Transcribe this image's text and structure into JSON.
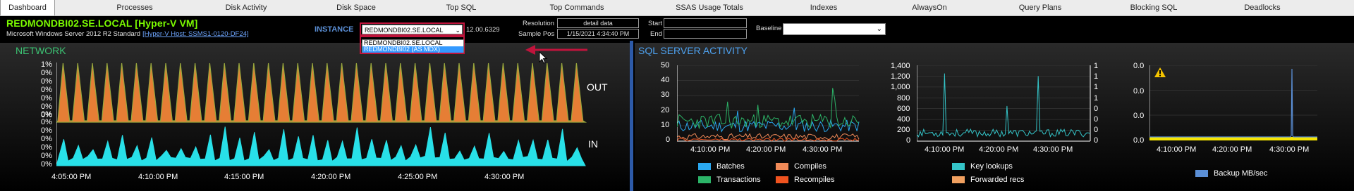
{
  "tabs": [
    {
      "label": "Dashboard",
      "active": true
    },
    {
      "label": "Processes"
    },
    {
      "label": "Disk Activity"
    },
    {
      "label": "Disk Space"
    },
    {
      "label": "Top SQL"
    },
    {
      "label": "Top Commands"
    },
    {
      "label": "SSAS Usage Totals"
    },
    {
      "label": "Indexes"
    },
    {
      "label": "AlwaysOn"
    },
    {
      "label": "Query Plans"
    },
    {
      "label": "Blocking SQL"
    },
    {
      "label": "Deadlocks"
    }
  ],
  "header": {
    "server_name": "REDMONDBI02.SE.LOCAL [Hyper-V VM]",
    "os": "Microsoft Windows Server 2012 R2 Standard",
    "host_link": "[Hyper-V Host: SSMS1-0120-DF24]",
    "instance_label": "INSTANCE",
    "instance_selected": "REDMONDBI02.SE.LOCAL",
    "version": "12.00.6329",
    "resolution_label": "Resolution",
    "resolution_value": "detail data",
    "sample_pos_label": "Sample Pos",
    "sample_pos_value": "1/15/2021 4:34:40 PM",
    "start_label": "Start",
    "end_label": "End",
    "baseline_label": "Baseline",
    "start_value": "",
    "end_value": "",
    "baseline_value": ""
  },
  "instance_options": [
    "REDMONDBI02.SE.LOCAL",
    "REDMONDBI02 (AS MDX)"
  ],
  "network": {
    "title": "NETWORK",
    "out_label": "OUT",
    "in_label": "IN",
    "out_yticks": [
      "1%",
      "0%",
      "0%",
      "0%",
      "0%",
      "0%",
      "0%",
      "0%",
      "0%"
    ],
    "in_yticks": [
      "0%",
      "0%",
      "0%",
      "0%",
      "0%",
      "0%",
      "0%",
      "0%"
    ],
    "xticks": [
      "4:05:00 PM",
      "4:10:00 PM",
      "4:15:00 PM",
      "4:20:00 PM",
      "4:25:00 PM",
      "4:30:00 PM"
    ]
  },
  "sql_activity": {
    "title": "SQL SERVER ACTIVITY",
    "c1_yticks": [
      "50",
      "40",
      "30",
      "20",
      "10",
      "0"
    ],
    "c1_xticks": [
      "4:10:00 PM",
      "4:20:00 PM",
      "4:30:00 PM"
    ],
    "c2_yticks": [
      "1,400",
      "1,200",
      "1,000",
      "800",
      "600",
      "400",
      "200",
      "0"
    ],
    "c2_y2ticks": [
      "1",
      "1",
      "1",
      "1",
      "0",
      "0",
      "0",
      "0"
    ],
    "c2_xticks": [
      "4:10:00 PM",
      "4:20:00 PM",
      "4:30:00 PM"
    ],
    "c3_yticks": [
      "0.0",
      "0.0",
      "0.0",
      "0.0"
    ],
    "c3_xticks": [
      "4:10:00 PM",
      "4:20:00 PM",
      "4:30:00 PM"
    ],
    "legend": {
      "batches": "Batches",
      "transactions": "Transactions",
      "compiles": "Compiles",
      "recompiles": "Recompiles",
      "key_lookups": "Key lookups",
      "forwarded_recs": "Forwarded recs",
      "backup": "Backup MB/sec"
    }
  },
  "colors": {
    "accent_green": "#7CFC00",
    "network_title": "#3cc373",
    "sql_title": "#4ea2f0",
    "out_fill": "#e67e35",
    "out_line": "#9aa83d",
    "in_fill": "#28e0e8",
    "batches": "#2aa8f0",
    "transactions": "#2cb468",
    "compiles": "#f08a58",
    "recompiles": "#f0531f",
    "key_lookups": "#34c4c8",
    "forwarded_recs": "#f0a060",
    "backup": "#5b8fd6",
    "highlight": "#c0143c"
  },
  "chart_data": [
    {
      "type": "area",
      "title": "",
      "series": [
        {
          "name": "OUT"
        },
        {
          "name": "IN"
        }
      ],
      "x": [
        "4:05:00 PM",
        "4:10:00 PM",
        "4:15:00 PM",
        "4:20:00 PM",
        "4:25:00 PM",
        "4:30:00 PM"
      ],
      "ylabel": "%"
    },
    {
      "type": "line",
      "title": "",
      "series": [
        {
          "name": "Batches"
        },
        {
          "name": "Transactions"
        },
        {
          "name": "Compiles"
        },
        {
          "name": "Recompiles"
        }
      ],
      "ylim": [
        0,
        50
      ],
      "x": [
        "4:10:00 PM",
        "4:20:00 PM",
        "4:30:00 PM"
      ]
    },
    {
      "type": "line",
      "title": "",
      "series": [
        {
          "name": "Key lookups"
        },
        {
          "name": "Forwarded recs"
        }
      ],
      "ylim": [
        0,
        1400
      ],
      "x": [
        "4:10:00 PM",
        "4:20:00 PM",
        "4:30:00 PM"
      ]
    },
    {
      "type": "line",
      "title": "",
      "series": [
        {
          "name": "Backup MB/sec"
        }
      ],
      "x": [
        "4:10:00 PM",
        "4:20:00 PM",
        "4:30:00 PM"
      ]
    }
  ]
}
